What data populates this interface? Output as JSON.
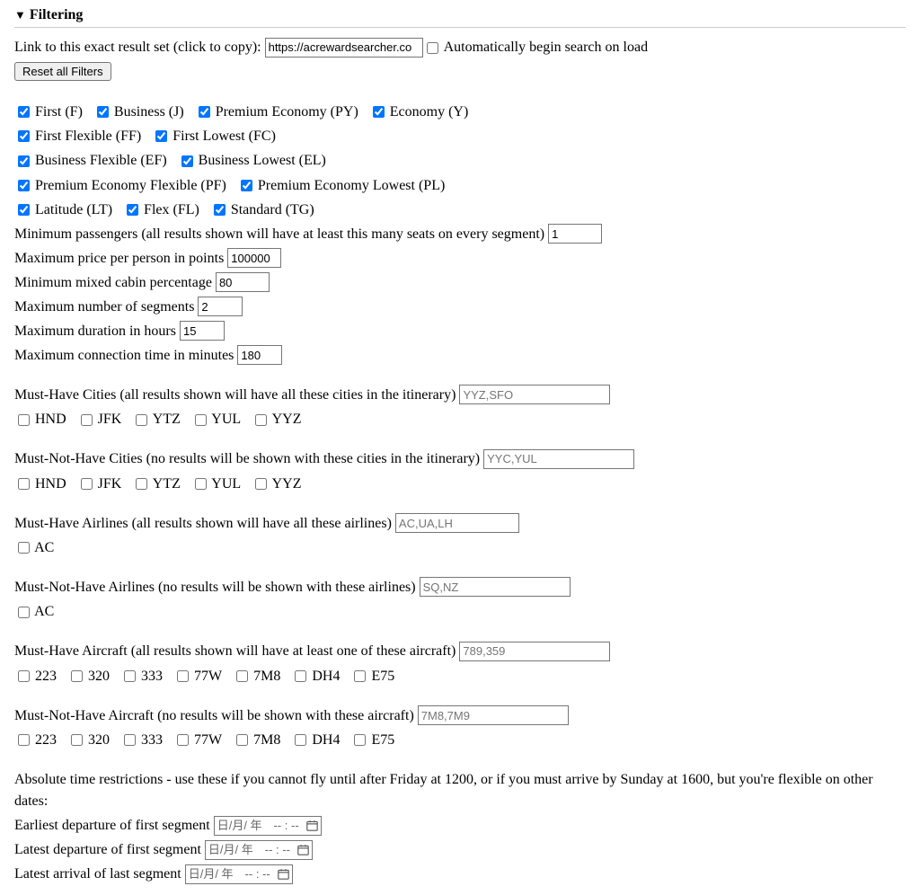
{
  "header": {
    "title": "Filtering"
  },
  "link_row": {
    "label": "Link to this exact result set (click to copy): ",
    "url_value": "https://acrewardsearcher.co",
    "auto_label": "Automatically begin search on load"
  },
  "reset_button": "Reset all Filters",
  "cabin_classes_line1": [
    {
      "label": "First (F)",
      "checked": true
    },
    {
      "label": "Business (J)",
      "checked": true
    },
    {
      "label": "Premium Economy (PY)",
      "checked": true
    },
    {
      "label": "Economy (Y)",
      "checked": true
    }
  ],
  "cabin_classes_line2": [
    {
      "label": "First Flexible (FF)",
      "checked": true
    },
    {
      "label": "First Lowest (FC)",
      "checked": true
    }
  ],
  "cabin_classes_line3": [
    {
      "label": "Business Flexible (EF)",
      "checked": true
    },
    {
      "label": "Business Lowest (EL)",
      "checked": true
    }
  ],
  "cabin_classes_line4": [
    {
      "label": "Premium Economy Flexible (PF)",
      "checked": true
    },
    {
      "label": "Premium Economy Lowest (PL)",
      "checked": true
    }
  ],
  "cabin_classes_line5": [
    {
      "label": "Latitude (LT)",
      "checked": true
    },
    {
      "label": "Flex (FL)",
      "checked": true
    },
    {
      "label": "Standard (TG)",
      "checked": true
    }
  ],
  "numeric_filters": {
    "min_pax_label": "Minimum passengers (all results shown will have at least this many seats on every segment) ",
    "min_pax_value": "1",
    "max_price_label": "Maximum price per person in points ",
    "max_price_value": "100000",
    "min_mixed_label": "Minimum mixed cabin percentage ",
    "min_mixed_value": "80",
    "max_segments_label": "Maximum number of segments ",
    "max_segments_value": "2",
    "max_duration_label": "Maximum duration in hours ",
    "max_duration_value": "15",
    "max_conn_label": "Maximum connection time in minutes ",
    "max_conn_value": "180"
  },
  "must_have_cities": {
    "label": "Must-Have Cities (all results shown will have all these cities in the itinerary) ",
    "placeholder": "YYZ,SFO",
    "options": [
      "HND",
      "JFK",
      "YTZ",
      "YUL",
      "YYZ"
    ]
  },
  "must_not_have_cities": {
    "label": "Must-Not-Have Cities (no results will be shown with these cities in the itinerary) ",
    "placeholder": "YYC,YUL",
    "options": [
      "HND",
      "JFK",
      "YTZ",
      "YUL",
      "YYZ"
    ]
  },
  "must_have_airlines": {
    "label": "Must-Have Airlines (all results shown will have all these airlines) ",
    "placeholder": "AC,UA,LH",
    "options": [
      "AC"
    ]
  },
  "must_not_have_airlines": {
    "label": "Must-Not-Have Airlines (no results will be shown with these airlines) ",
    "placeholder": "SQ,NZ",
    "options": [
      "AC"
    ]
  },
  "must_have_aircraft": {
    "label": "Must-Have Aircraft (all results shown will have at least one of these aircraft) ",
    "placeholder": "789,359",
    "options": [
      "223",
      "320",
      "333",
      "77W",
      "7M8",
      "DH4",
      "E75"
    ]
  },
  "must_not_have_aircraft": {
    "label": "Must-Not-Have Aircraft (no results will be shown with these aircraft) ",
    "placeholder": "7M8,7M9",
    "options": [
      "223",
      "320",
      "333",
      "77W",
      "7M8",
      "DH4",
      "E75"
    ]
  },
  "time_restrictions": {
    "intro": "Absolute time restrictions - use these if you cannot fly until after Friday at 1200, or if you must arrive by Sunday at 1600, but you're flexible on other dates:",
    "earliest_dep_label": "Earliest departure of first segment ",
    "latest_dep_label": "Latest departure of first segment ",
    "latest_arr_label": "Latest arrival of last segment ",
    "datetime_placeholder": "日/月/ 年　-- : --"
  }
}
